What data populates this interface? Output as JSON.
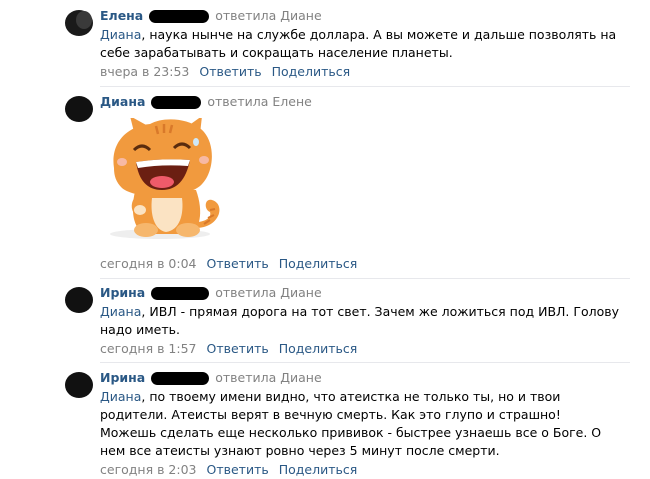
{
  "comments": [
    {
      "author": "Елена",
      "reply": "ответила Диане",
      "mention": "Диана",
      "text": ", наука нынче на службе доллара. А вы можете и дальше позволять на себе зарабатывать и сокращать население планеты.",
      "time": "вчера в 23:53",
      "reply_action": "Ответить",
      "share_action": "Поделиться"
    },
    {
      "author": "Диана",
      "reply": "ответила Елене",
      "time": "сегодня в 0:04",
      "reply_action": "Ответить",
      "share_action": "Поделиться"
    },
    {
      "author": "Ирина",
      "reply": "ответила Диане",
      "mention": "Диана",
      "text": ", ИВЛ - прямая дорога на тот свет. Зачем же ложиться под ИВЛ. Голову надо иметь.",
      "time": "сегодня в 1:57",
      "reply_action": "Ответить",
      "share_action": "Поделиться"
    },
    {
      "author": "Ирина",
      "reply": "ответила Диане",
      "mention": "Диана",
      "text": ", по твоему имени видно, что атеистка не только ты, но и твои родители. Атеисты верят в вечную смерть. Как это глупо и страшно! Можешь сделать еще несколько прививок - быстрее узнаешь все о Боге. О нем все атеисты узнают ровно через 5 минут после смерти.",
      "time": "сегодня в 2:03",
      "reply_action": "Ответить",
      "share_action": "Поделиться"
    }
  ],
  "colors": {
    "link": "#2a5885",
    "secondary": "#828282",
    "divider": "#e7e8ec",
    "cat_orange": "#f19a3e"
  }
}
